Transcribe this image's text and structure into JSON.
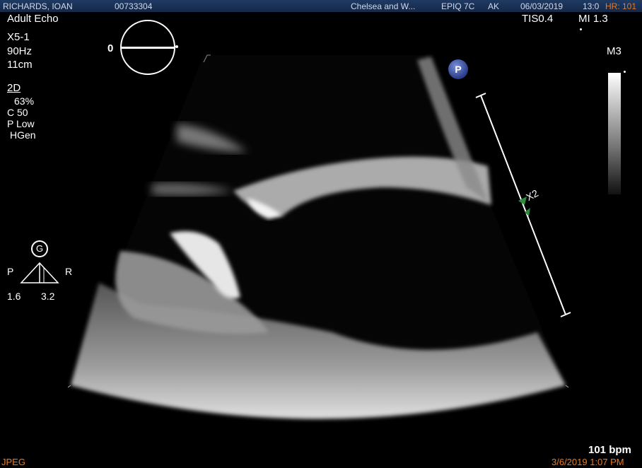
{
  "header": {
    "patient_name": "RICHARDS, IOAN",
    "patient_id": "00733304",
    "institution": "Chelsea and W...",
    "system": "EPIQ 7C",
    "operator": "AK",
    "date": "06/03/2019",
    "time": "13:0",
    "hr_label": "HR: 101"
  },
  "left_panel": {
    "exam": "Adult Echo",
    "probe": "X5-1",
    "frame_rate": "90Hz",
    "depth": "11cm",
    "mode": "2D",
    "gain": "63%",
    "compression": "C 50",
    "power": "P Low",
    "freq": "HGen"
  },
  "right_panel": {
    "tis": "TIS0.4",
    "mi": "MI 1.3",
    "map": "M3"
  },
  "orientation": {
    "angle": "0"
  },
  "probe_marker": "P",
  "focus": {
    "g_label": "G",
    "p_label": "P",
    "r_label": "R",
    "left_value": "1.6",
    "right_value": "3.2"
  },
  "zoom": {
    "label": "X2"
  },
  "footer": {
    "heart_rate": "101 bpm",
    "format": "JPEG",
    "timestamp": "3/6/2019 1:07 PM"
  },
  "colors": {
    "header_bg": "#1f3a63",
    "footer_text": "#e87a1f",
    "marker_green": "#2e8b3e",
    "probe_badge": "#2a3c8a"
  }
}
